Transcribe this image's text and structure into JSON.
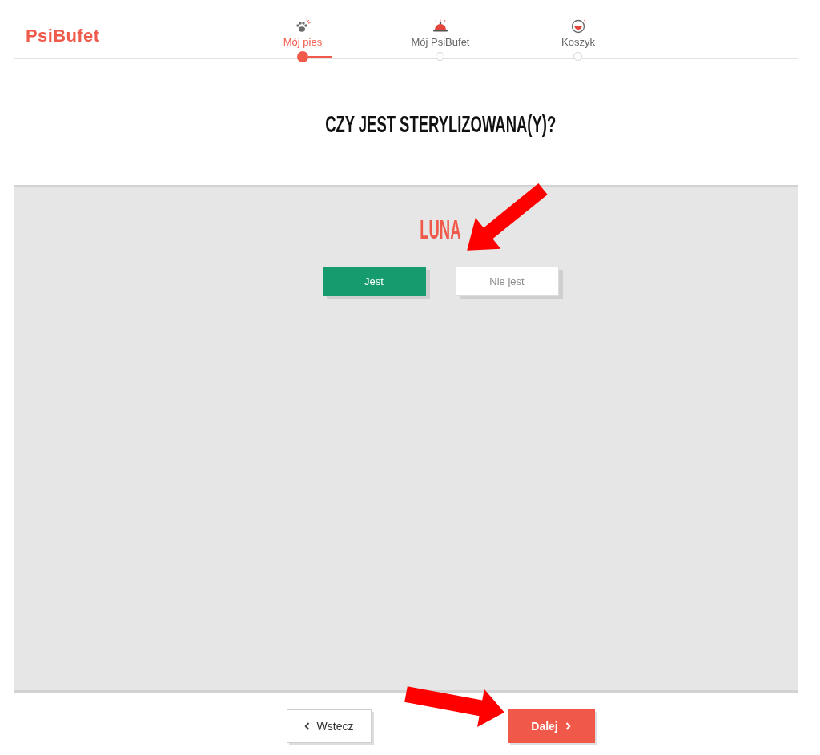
{
  "header": {
    "logo": "PsiBufet"
  },
  "steps": [
    {
      "label": "Mój pies",
      "selected": true,
      "kind": "paw"
    },
    {
      "label": "Mój PsiBufet",
      "selected": false,
      "kind": "cloche"
    },
    {
      "label": "Koszyk",
      "selected": false,
      "kind": "bowl"
    }
  ],
  "question": {
    "title": "CZY JEST STERYLIZOWANA(Y)?"
  },
  "pet": {
    "name": "LUNA",
    "options": [
      {
        "label": "Jest",
        "selected": true
      },
      {
        "label": "Nie jest",
        "selected": false
      }
    ]
  },
  "navigation": {
    "back": "Wstecz",
    "next": "Dalej"
  }
}
